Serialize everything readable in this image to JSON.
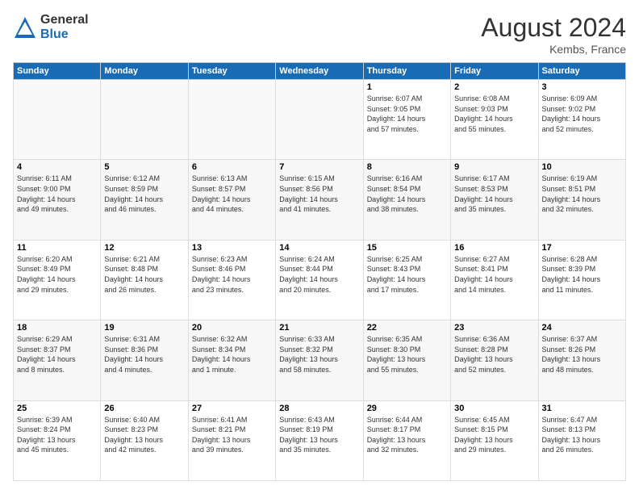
{
  "header": {
    "logo_general": "General",
    "logo_blue": "Blue",
    "month_year": "August 2024",
    "location": "Kembs, France"
  },
  "weekdays": [
    "Sunday",
    "Monday",
    "Tuesday",
    "Wednesday",
    "Thursday",
    "Friday",
    "Saturday"
  ],
  "weeks": [
    [
      {
        "day": "",
        "info": ""
      },
      {
        "day": "",
        "info": ""
      },
      {
        "day": "",
        "info": ""
      },
      {
        "day": "",
        "info": ""
      },
      {
        "day": "1",
        "info": "Sunrise: 6:07 AM\nSunset: 9:05 PM\nDaylight: 14 hours\nand 57 minutes."
      },
      {
        "day": "2",
        "info": "Sunrise: 6:08 AM\nSunset: 9:03 PM\nDaylight: 14 hours\nand 55 minutes."
      },
      {
        "day": "3",
        "info": "Sunrise: 6:09 AM\nSunset: 9:02 PM\nDaylight: 14 hours\nand 52 minutes."
      }
    ],
    [
      {
        "day": "4",
        "info": "Sunrise: 6:11 AM\nSunset: 9:00 PM\nDaylight: 14 hours\nand 49 minutes."
      },
      {
        "day": "5",
        "info": "Sunrise: 6:12 AM\nSunset: 8:59 PM\nDaylight: 14 hours\nand 46 minutes."
      },
      {
        "day": "6",
        "info": "Sunrise: 6:13 AM\nSunset: 8:57 PM\nDaylight: 14 hours\nand 44 minutes."
      },
      {
        "day": "7",
        "info": "Sunrise: 6:15 AM\nSunset: 8:56 PM\nDaylight: 14 hours\nand 41 minutes."
      },
      {
        "day": "8",
        "info": "Sunrise: 6:16 AM\nSunset: 8:54 PM\nDaylight: 14 hours\nand 38 minutes."
      },
      {
        "day": "9",
        "info": "Sunrise: 6:17 AM\nSunset: 8:53 PM\nDaylight: 14 hours\nand 35 minutes."
      },
      {
        "day": "10",
        "info": "Sunrise: 6:19 AM\nSunset: 8:51 PM\nDaylight: 14 hours\nand 32 minutes."
      }
    ],
    [
      {
        "day": "11",
        "info": "Sunrise: 6:20 AM\nSunset: 8:49 PM\nDaylight: 14 hours\nand 29 minutes."
      },
      {
        "day": "12",
        "info": "Sunrise: 6:21 AM\nSunset: 8:48 PM\nDaylight: 14 hours\nand 26 minutes."
      },
      {
        "day": "13",
        "info": "Sunrise: 6:23 AM\nSunset: 8:46 PM\nDaylight: 14 hours\nand 23 minutes."
      },
      {
        "day": "14",
        "info": "Sunrise: 6:24 AM\nSunset: 8:44 PM\nDaylight: 14 hours\nand 20 minutes."
      },
      {
        "day": "15",
        "info": "Sunrise: 6:25 AM\nSunset: 8:43 PM\nDaylight: 14 hours\nand 17 minutes."
      },
      {
        "day": "16",
        "info": "Sunrise: 6:27 AM\nSunset: 8:41 PM\nDaylight: 14 hours\nand 14 minutes."
      },
      {
        "day": "17",
        "info": "Sunrise: 6:28 AM\nSunset: 8:39 PM\nDaylight: 14 hours\nand 11 minutes."
      }
    ],
    [
      {
        "day": "18",
        "info": "Sunrise: 6:29 AM\nSunset: 8:37 PM\nDaylight: 14 hours\nand 8 minutes."
      },
      {
        "day": "19",
        "info": "Sunrise: 6:31 AM\nSunset: 8:36 PM\nDaylight: 14 hours\nand 4 minutes."
      },
      {
        "day": "20",
        "info": "Sunrise: 6:32 AM\nSunset: 8:34 PM\nDaylight: 14 hours\nand 1 minute."
      },
      {
        "day": "21",
        "info": "Sunrise: 6:33 AM\nSunset: 8:32 PM\nDaylight: 13 hours\nand 58 minutes."
      },
      {
        "day": "22",
        "info": "Sunrise: 6:35 AM\nSunset: 8:30 PM\nDaylight: 13 hours\nand 55 minutes."
      },
      {
        "day": "23",
        "info": "Sunrise: 6:36 AM\nSunset: 8:28 PM\nDaylight: 13 hours\nand 52 minutes."
      },
      {
        "day": "24",
        "info": "Sunrise: 6:37 AM\nSunset: 8:26 PM\nDaylight: 13 hours\nand 48 minutes."
      }
    ],
    [
      {
        "day": "25",
        "info": "Sunrise: 6:39 AM\nSunset: 8:24 PM\nDaylight: 13 hours\nand 45 minutes."
      },
      {
        "day": "26",
        "info": "Sunrise: 6:40 AM\nSunset: 8:23 PM\nDaylight: 13 hours\nand 42 minutes."
      },
      {
        "day": "27",
        "info": "Sunrise: 6:41 AM\nSunset: 8:21 PM\nDaylight: 13 hours\nand 39 minutes."
      },
      {
        "day": "28",
        "info": "Sunrise: 6:43 AM\nSunset: 8:19 PM\nDaylight: 13 hours\nand 35 minutes."
      },
      {
        "day": "29",
        "info": "Sunrise: 6:44 AM\nSunset: 8:17 PM\nDaylight: 13 hours\nand 32 minutes."
      },
      {
        "day": "30",
        "info": "Sunrise: 6:45 AM\nSunset: 8:15 PM\nDaylight: 13 hours\nand 29 minutes."
      },
      {
        "day": "31",
        "info": "Sunrise: 6:47 AM\nSunset: 8:13 PM\nDaylight: 13 hours\nand 26 minutes."
      }
    ]
  ]
}
